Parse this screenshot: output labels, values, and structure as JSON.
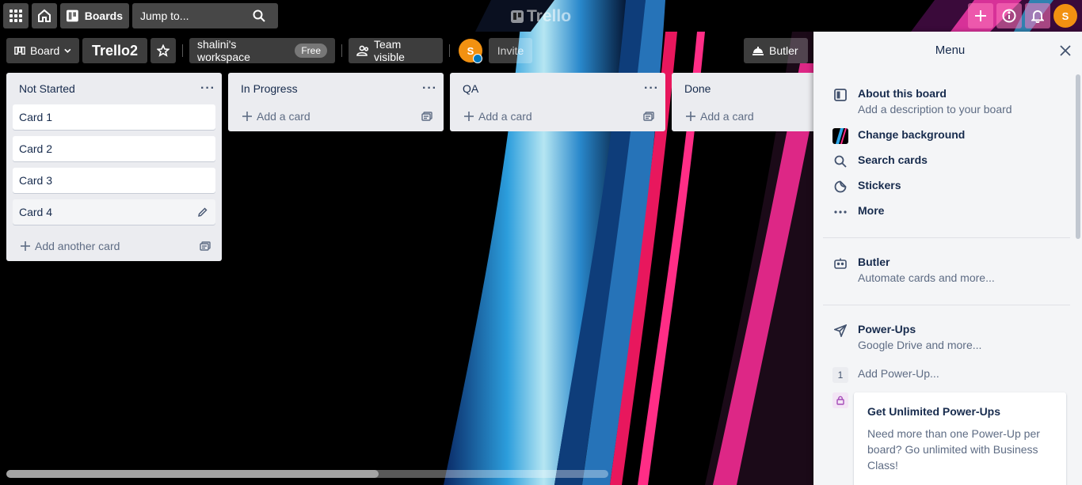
{
  "header": {
    "boards_label": "Boards",
    "search_placeholder": "Jump to...",
    "logo_text": "Trello",
    "user_initial": "S"
  },
  "board_bar": {
    "view_label": "Board",
    "board_name": "Trello2",
    "workspace_name": "shalini's workspace",
    "workspace_badge": "Free",
    "visibility_label": "Team visible",
    "member_initial": "S",
    "invite_label": "Invite",
    "butler_label": "Butler"
  },
  "lists": [
    {
      "title": "Not Started",
      "cards": [
        "Card 1",
        "Card 2",
        "Card 3",
        "Card 4"
      ],
      "add_label": "Add another card"
    },
    {
      "title": "In Progress",
      "cards": [],
      "add_label": "Add a card"
    },
    {
      "title": "QA",
      "cards": [],
      "add_label": "Add a card"
    },
    {
      "title": "Done",
      "cards": [],
      "add_label": "Add a card"
    }
  ],
  "menu": {
    "title": "Menu",
    "about_title": "About this board",
    "about_desc": "Add a description to your board",
    "change_bg": "Change background",
    "search_cards": "Search cards",
    "stickers": "Stickers",
    "more": "More",
    "butler_title": "Butler",
    "butler_desc": "Automate cards and more...",
    "powerups_title": "Power-Ups",
    "powerups_desc": "Google Drive and more...",
    "powerup_count": "1",
    "add_powerup": "Add Power-Up...",
    "upsell_title": "Get Unlimited Power-Ups",
    "upsell_text": "Need more than one Power-Up per board? Go unlimited with Business Class!"
  },
  "colors": {
    "list_bg": "#ebecf0",
    "menu_bg": "#f4f5f7",
    "avatar": "#f29111",
    "accent_pink": "#ff2d86",
    "accent_cyan": "#3ec5ff"
  }
}
